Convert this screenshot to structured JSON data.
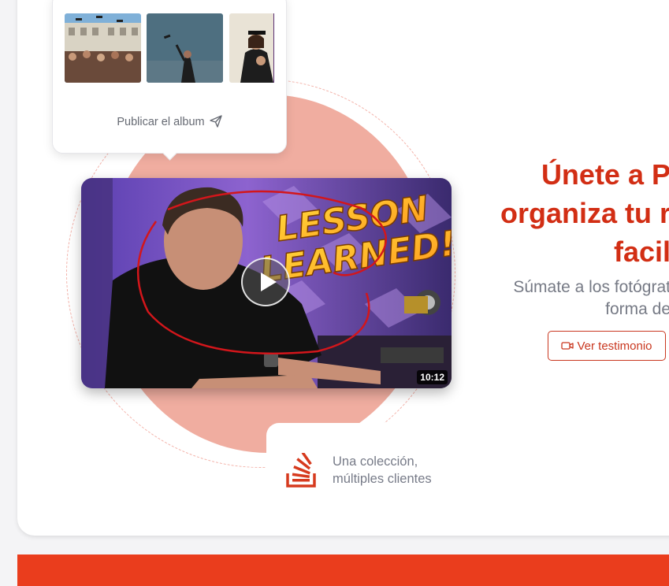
{
  "album": {
    "publish_label": "Publicar el album",
    "thumbnails": [
      "graduation-crowd-photo",
      "graduate-throwing-cap-photo",
      "graduate-portrait-photo"
    ]
  },
  "video": {
    "overlay_text": "LESSON LEARNED!",
    "duration": "10:12"
  },
  "feature_tag": {
    "line1": "Una colección,",
    "line2": "múltiples clientes"
  },
  "hero": {
    "title_line1": "Únete a P",
    "title_line2": "organiza tu r",
    "title_line3": "facil",
    "subtitle_line1": "Súmate a los fotógrat",
    "subtitle_line2": "forma de",
    "testimonial_label": "Ver testimonio"
  },
  "colors": {
    "accent": "#d22e14",
    "bottom_bar": "#ea3d1d",
    "circle": "#f0ada0"
  }
}
